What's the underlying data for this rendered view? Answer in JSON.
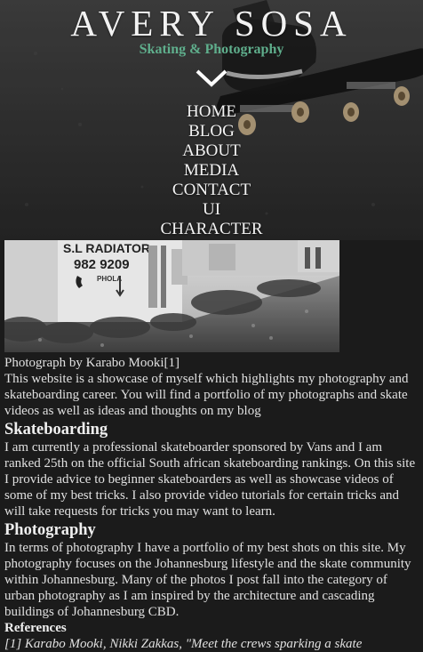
{
  "header": {
    "title": "AVERY SOSA",
    "subtitle": "Skating & Photography",
    "menu_icon": "chevron-down-icon"
  },
  "nav": {
    "items": [
      "HOME",
      "BLOG",
      "ABOUT",
      "MEDIA",
      "CONTACT",
      "UI",
      "CHARACTER"
    ]
  },
  "photo": {
    "sign_name": "S.L RADIATOR",
    "sign_phone": "982 9209",
    "sign_small": "PHOLA",
    "caption": "Photograph by Karabo Mooki[1]"
  },
  "intro": "This website is a showcase of myself which highlights my photography and skateboarding career. You will find a portfolio of my photographs and skate videos as well as ideas and thoughts on my blog",
  "sections": [
    {
      "heading": "Skateboarding",
      "body": "I am currently a professional skateboarder sponsored by Vans and I am ranked 25th on the official South african skateboarding rankings. On this site I provide advice to beginner skateboarders as well as showcase videos of some of my best tricks. I also provide video tutorials for certain tricks and will take requests for tricks you may want to learn."
    },
    {
      "heading": "Photography",
      "body": "In terms of photography I have a portfolio of my best shots on this site. My photography focuses on the Johannesburg lifestyle and the skate community within Johannesburg. Many of the photos I post fall into the category of urban photography as I am inspired by the architecture and cascading buildings of Johannesburg CBD."
    }
  ],
  "references": {
    "heading": "References",
    "items": [
      "[1] Karabo Mooki, Nikki Zakkas, \"Meet the crews sparking a skate"
    ]
  },
  "colors": {
    "subtitle": "#5fae8c",
    "background": "#1b1b1b",
    "text": "#e0e0e0"
  }
}
